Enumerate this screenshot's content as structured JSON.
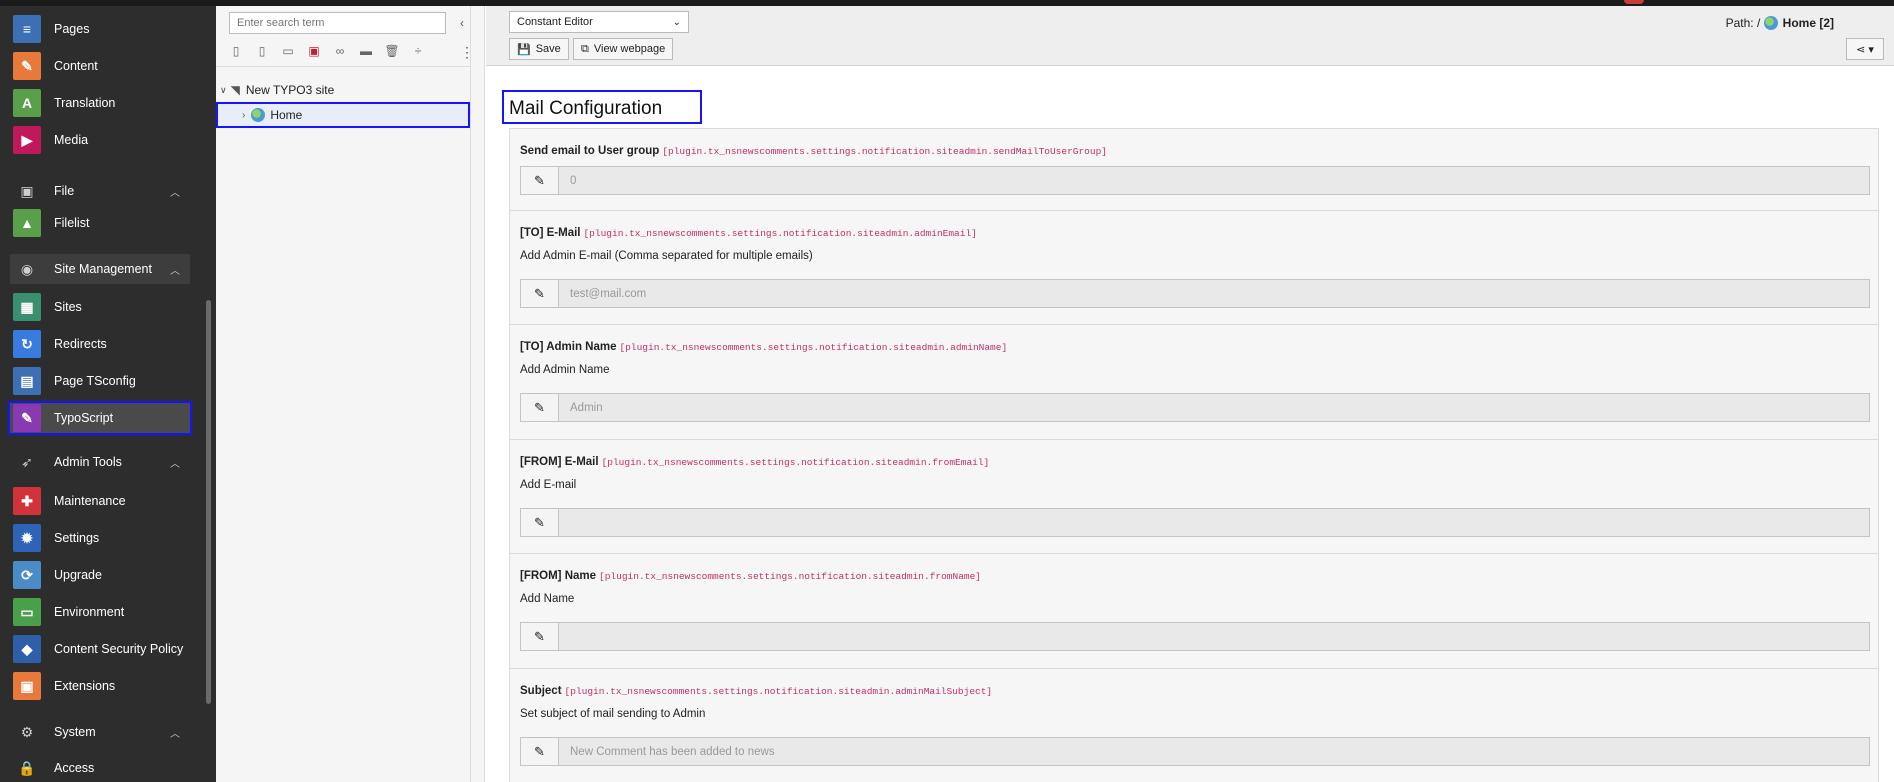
{
  "modules": {
    "web_items": [
      {
        "label": "Pages",
        "icon": "pages-icon",
        "color": "#3d6fb4",
        "glyph": "≡"
      },
      {
        "label": "Content",
        "icon": "content-icon",
        "color": "#e8793a",
        "glyph": "✎"
      },
      {
        "label": "Translation",
        "icon": "translation-icon",
        "color": "#5aa04a",
        "glyph": "A"
      },
      {
        "label": "Media",
        "icon": "media-icon",
        "color": "#c0185a",
        "glyph": "▶"
      }
    ],
    "file_group": "File",
    "file_items": [
      {
        "label": "Filelist",
        "icon": "filelist-icon",
        "color": "#5aa04a",
        "glyph": "▲"
      }
    ],
    "site_group": "Site Management",
    "site_items": [
      {
        "label": "Sites",
        "icon": "sites-icon",
        "color": "#3a8f6f",
        "glyph": "▦"
      },
      {
        "label": "Redirects",
        "icon": "redirects-icon",
        "color": "#3a7be0",
        "glyph": "↻"
      },
      {
        "label": "Page TSconfig",
        "icon": "page-tsconfig-icon",
        "color": "#3d6fb4",
        "glyph": "▤"
      },
      {
        "label": "TypoScript",
        "icon": "typoscript-icon",
        "color": "#8a3ab0",
        "glyph": "✎"
      }
    ],
    "admin_group": "Admin Tools",
    "admin_items": [
      {
        "label": "Maintenance",
        "icon": "maintenance-icon",
        "color": "#d2333a",
        "glyph": "✚"
      },
      {
        "label": "Settings",
        "icon": "settings-icon",
        "color": "#2e63b8",
        "glyph": "✹"
      },
      {
        "label": "Upgrade",
        "icon": "upgrade-icon",
        "color": "#4a8cc8",
        "glyph": "⟳"
      },
      {
        "label": "Environment",
        "icon": "environment-icon",
        "color": "#4aa04a",
        "glyph": "▭"
      },
      {
        "label": "Content Security Policy",
        "icon": "csp-icon",
        "color": "#2e5fa8",
        "glyph": "◆"
      },
      {
        "label": "Extensions",
        "icon": "extensions-icon",
        "color": "#e8793a",
        "glyph": "▣"
      }
    ],
    "system_group": "System",
    "system_items": [
      {
        "label": "Access",
        "icon": "access-icon",
        "color": "#2d2d2d",
        "glyph": "🔒"
      }
    ]
  },
  "tree": {
    "search_placeholder": "Enter search term",
    "root": "New TYPO3 site",
    "home": "Home"
  },
  "header": {
    "mode_select": "Constant Editor",
    "save_label": "Save",
    "view_label": "View webpage",
    "path_prefix": "Path: /",
    "path_page": "Home [2]"
  },
  "content": {
    "title": "Mail Configuration",
    "items": [
      {
        "label": "Send email to User group",
        "key": "[plugin.tx_nsnewscomments.settings.notification.siteadmin.sendMailToUserGroup]",
        "desc": "",
        "value": "0"
      },
      {
        "label": "[TO] E-Mail",
        "key": "[plugin.tx_nsnewscomments.settings.notification.siteadmin.adminEmail]",
        "desc": "Add Admin E-mail (Comma separated for multiple emails)",
        "value": "test@mail.com"
      },
      {
        "label": "[TO] Admin Name",
        "key": "[plugin.tx_nsnewscomments.settings.notification.siteadmin.adminName]",
        "desc": "Add Admin Name",
        "value": "Admin"
      },
      {
        "label": "[FROM] E-Mail",
        "key": "[plugin.tx_nsnewscomments.settings.notification.siteadmin.fromEmail]",
        "desc": "Add E-mail",
        "value": ""
      },
      {
        "label": "[FROM] Name",
        "key": "[plugin.tx_nsnewscomments.settings.notification.siteadmin.fromName]",
        "desc": "Add Name",
        "value": ""
      },
      {
        "label": "Subject",
        "key": "[plugin.tx_nsnewscomments.settings.notification.siteadmin.adminMailSubject]",
        "desc": "Set subject of mail sending to Admin",
        "value": "New Comment has been added to news"
      }
    ]
  }
}
